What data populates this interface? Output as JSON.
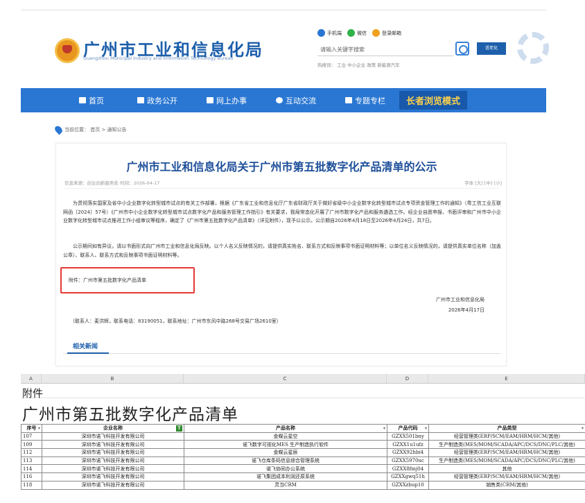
{
  "header": {
    "site_title": "广州市工业和信息化局",
    "site_subtitle": "Guangzhou Municipal Industry and Information Technology Bureau",
    "top_links": [
      "手机端",
      "微信",
      "登录邮箱"
    ],
    "search_placeholder": "请输入关键字搜索",
    "access_badge": "适老化",
    "hot_words": "热搜词：  工业   中小企业   政策   新能源汽车",
    "colors": {
      "brand": "#1d5fab",
      "nav": "#2a77d3"
    }
  },
  "nav": {
    "items": [
      "首页",
      "政务公开",
      "网上办事",
      "互动交流",
      "专题专栏"
    ],
    "elder_mode": "长者浏览模式"
  },
  "breadcrumb": "当前位置：  首页 > 通知公告",
  "article": {
    "title": "广州市工业和信息化局关于广州市第五批数字化产品清单的公示",
    "meta": "信息来源：创业创新服务处  时间：2026-04-17",
    "font_size": "字体  [大] [中] [小]",
    "para1": "为贯彻落实国家及省中小企业数字化转型城市试点的有关工作部署，根据《广东省工业和信息化厅广东省财政厅关于做好省级中小企业数字化转型城市试点专项资金管理工作的通知》（粤工信工业互联网函〔2024〕57号）《广州市中小企业数字化转型城市试点数字化产品和服务管理工作指引》有关要求，我局常态化开展了广州市数字化产品和服务遴选工作。经企业自愿申报、书面评审和广州市中小企业数字化转型城市试点推进工作小组审议等程序，确定了《广州市第五批数字化产品清单》（详见附件），现予以公示。公示期自2026年4月18日至2026年4月24日，共7日。",
    "para2": "公示期间如有异议，请以书面形式向广州市工业和信息化局反映。以个人名义反映情况的，请提供真实姓名、联系方式和反映事项书面证明材料等；以单位名义反映情况的，请提供真实单位名称（加盖公章）、联系人、联系方式和反映事项书面证明材料等。",
    "attachment": "附件：广州市第五批数字化产品清单",
    "sign_org": "广州市工业和信息化局",
    "sign_date": "2026年4月17日",
    "contact": "（联系人：麦洪辉，联系电话：83190051，联系地址：广州市东风中路268号交易广场2610室）",
    "related": "相关新闻"
  },
  "sheet": {
    "col_letters": [
      "A",
      "B",
      "C",
      "D",
      "E"
    ],
    "fujian": "附件",
    "title": "广州市第五批数字化产品清单",
    "headers": [
      "序号",
      "企业名称",
      "产品名称",
      "产品代码",
      "产品类型"
    ],
    "rows": [
      [
        "107",
        "深圳市诺飞科技开发有限公司",
        "金蝶云星空",
        "GZXX501bny",
        "经营管理类(ERP/SCM/EAM/HRM/HCM/其他)"
      ],
      [
        "109",
        "深圳市诺飞科技开发有限公司",
        "诺飞数字可视化MES 生产制造执行软件",
        "GZXX1u1ufz",
        "生产制造类(MES/MOM/SCADA/APC/DCS/DNC/PLC/其他)"
      ],
      [
        "112",
        "深圳市诺飞科技开发有限公司",
        "金蝶云星辰",
        "GZXX92hbi4",
        "经营管理类(ERP/SCM/EAM/HRM/HCM/其他)"
      ],
      [
        "113",
        "深圳市诺飞科技开发有限公司",
        "诺飞仓库条码信息综合管理系统",
        "GZXX5970uc",
        "生产制造类(MES/MOM/SCADA/APC/DCS/DNC/PLC/其他)"
      ],
      [
        "114",
        "深圳市诺飞科技开发有限公司",
        "诺飞协同办公系统",
        "GZXX8fmj04",
        "其他"
      ],
      [
        "116",
        "深圳市诺飞科技开发有限公司",
        "诺飞集团成本利润还原系统",
        "GZXXgwq51h",
        "经营管理类(ERP/SCM/EAM/HRM/HCM/其他)"
      ],
      [
        "118",
        "深圳市诺飞科技开发有限公司",
        "灵当CRM",
        "GZXXzbup10",
        "销售类(CRM/其他)"
      ]
    ]
  }
}
